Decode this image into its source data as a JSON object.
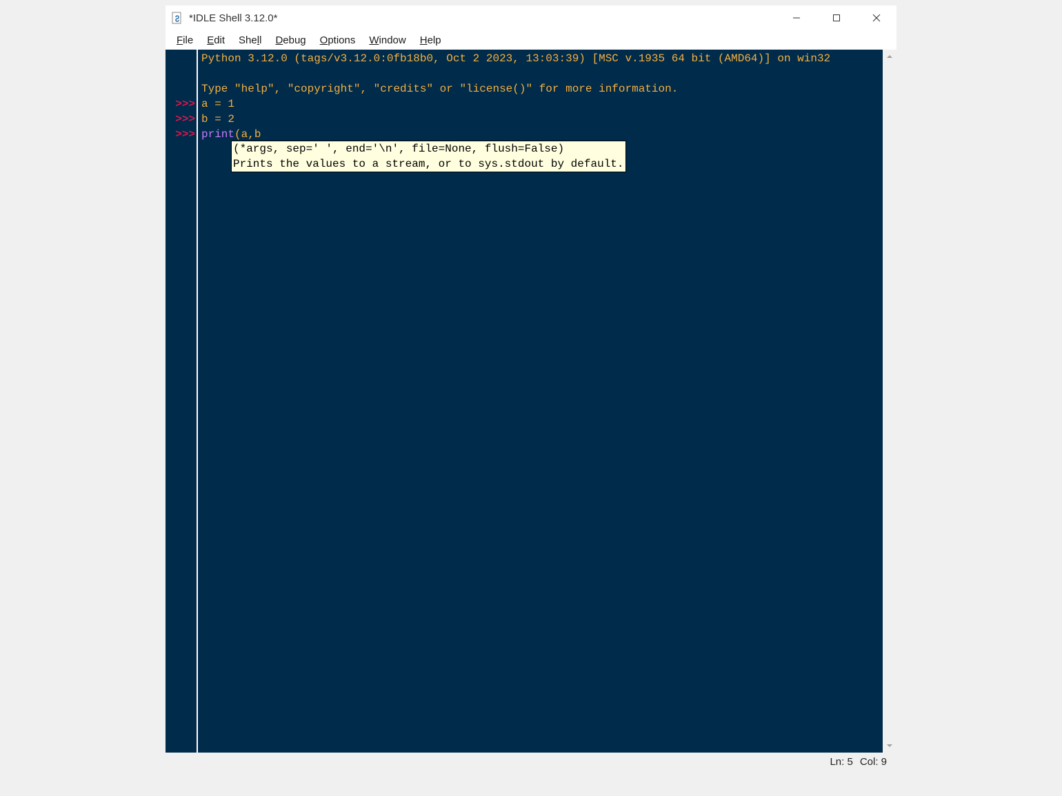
{
  "titlebar": {
    "title": "*IDLE Shell 3.12.0*"
  },
  "menubar": {
    "items": [
      {
        "u": "F",
        "rest": "ile"
      },
      {
        "u": "E",
        "rest": "dit"
      },
      {
        "pre": "She",
        "u": "l",
        "rest": "l"
      },
      {
        "u": "D",
        "rest": "ebug"
      },
      {
        "u": "O",
        "rest": "ptions"
      },
      {
        "u": "W",
        "rest": "indow"
      },
      {
        "u": "H",
        "rest": "elp"
      }
    ]
  },
  "shell": {
    "banner_line1": "Python 3.12.0 (tags/v3.12.0:0fb18b0, Oct  2 2023, 13:03:39) [MSC v.1935 64 bit (AMD64)] on win32",
    "banner_line2": "Type \"help\", \"copyright\", \"credits\" or \"license()\" for more information.",
    "prompt": ">>>",
    "lines": [
      {
        "prompt": true,
        "segments": [
          {
            "cls": "orange",
            "text": "a = 1"
          }
        ]
      },
      {
        "prompt": true,
        "segments": [
          {
            "cls": "orange",
            "text": "b = 2"
          }
        ]
      },
      {
        "prompt": true,
        "segments": [
          {
            "cls": "builtin",
            "text": "print"
          },
          {
            "cls": "orange",
            "text": "(a,b"
          }
        ]
      }
    ],
    "calltip": {
      "line1": "(*args, sep=' ', end='\\n', file=None, flush=False)",
      "line2": "Prints the values to a stream, or to sys.stdout by default."
    }
  },
  "statusbar": {
    "ln_label": "Ln: 5",
    "col_label": "Col: 9"
  }
}
